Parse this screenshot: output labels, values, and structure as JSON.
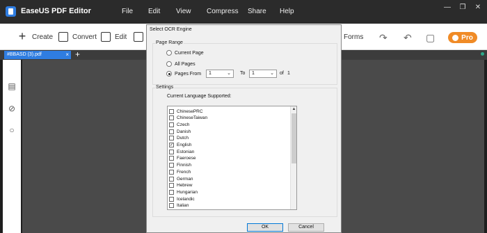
{
  "app": {
    "title": "EaseUS PDF Editor"
  },
  "menu": [
    "File",
    "Edit",
    "View",
    "Compress",
    "Share",
    "Help"
  ],
  "window_controls": {
    "minimize": "—",
    "restore": "❐",
    "close": "✕"
  },
  "toolbar": {
    "create": "Create",
    "convert": "Convert",
    "edit": "Edit",
    "forms": "Forms",
    "pro": "Pro"
  },
  "tab": {
    "label": "#BBASD (3).pdf",
    "close": "×",
    "add": "+"
  },
  "dialog": {
    "title": "Select OCR Engine",
    "page_range": {
      "label": "Page Range",
      "options": [
        "Current Page",
        "All Pages",
        "Pages From"
      ],
      "selected": "Pages From",
      "from_value": "1",
      "to_label": "To",
      "to_value": "1",
      "of_label": "of",
      "total_pages": "1"
    },
    "settings": {
      "label": "Settings",
      "current_language_label": "Current Language Supported:",
      "languages": [
        {
          "name": "ChinesePRC",
          "checked": false
        },
        {
          "name": "ChineseTaiwan",
          "checked": false
        },
        {
          "name": "Czech",
          "checked": false
        },
        {
          "name": "Danish",
          "checked": false
        },
        {
          "name": "Dutch",
          "checked": false
        },
        {
          "name": "English",
          "checked": true
        },
        {
          "name": "Estonian",
          "checked": false
        },
        {
          "name": "Faeroese",
          "checked": false
        },
        {
          "name": "Finnish",
          "checked": false
        },
        {
          "name": "French",
          "checked": false
        },
        {
          "name": "German",
          "checked": false
        },
        {
          "name": "Hebrew",
          "checked": false
        },
        {
          "name": "Hungarian",
          "checked": false
        },
        {
          "name": "Icelandic",
          "checked": false
        },
        {
          "name": "Italian",
          "checked": false
        }
      ]
    },
    "ok": "OK",
    "cancel": "Cancel"
  },
  "colors": {
    "accent": "#2f7de1",
    "pro": "#f08b26"
  }
}
